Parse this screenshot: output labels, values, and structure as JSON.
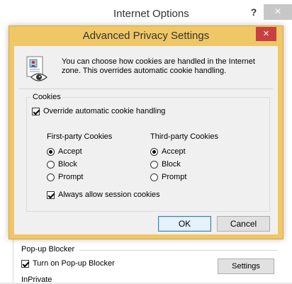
{
  "background_window": {
    "title": "Internet Options",
    "help_glyph": "?",
    "close_glyph": "×",
    "popup_blocker": {
      "section_label": "Pop-up Blocker",
      "checkbox_label": "Turn on Pop-up Blocker",
      "checked": true,
      "settings_button": "Settings"
    },
    "inprivate_label": "InPrivate"
  },
  "dialog": {
    "title": "Advanced Privacy Settings",
    "close_glyph": "×",
    "accent_color": "#f0c766",
    "close_color": "#c94040",
    "icon": "privacy-document-eye-icon",
    "intro_text": "You can choose how cookies are handled in the Internet zone.  This overrides automatic cookie handling.",
    "cookies": {
      "group_label": "Cookies",
      "override_label": "Override automatic cookie handling",
      "override_checked": true,
      "first_party": {
        "header": "First-party Cookies",
        "options": [
          "Accept",
          "Block",
          "Prompt"
        ],
        "selected": "Accept"
      },
      "third_party": {
        "header": "Third-party Cookies",
        "options": [
          "Accept",
          "Block",
          "Prompt"
        ],
        "selected": "Accept"
      },
      "session_label": "Always allow session cookies",
      "session_checked": true
    },
    "buttons": {
      "ok": "OK",
      "cancel": "Cancel"
    }
  }
}
